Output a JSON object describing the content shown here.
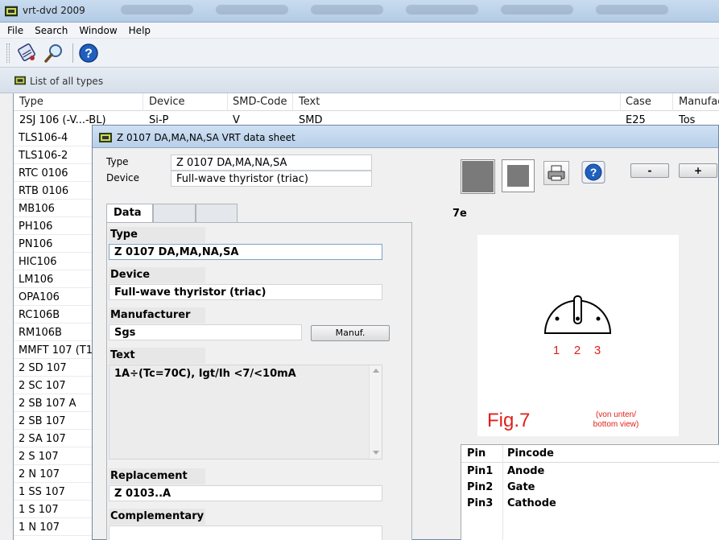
{
  "window": {
    "title": "vrt-dvd 2009"
  },
  "menu": [
    "File",
    "Search",
    "Window",
    "Help"
  ],
  "panel": {
    "caption": "List of all types"
  },
  "list": {
    "columns": [
      "Type",
      "Device",
      "SMD-Code",
      "Text",
      "Case",
      "Manufac"
    ],
    "first_row": {
      "type": "2SJ 106   (-V...-BL)",
      "device": "Si-P",
      "smd": "V",
      "text": "SMD",
      "case": "E25",
      "manufacturer": "Tos"
    },
    "types": [
      "TLS106-4",
      "TLS106-2",
      "RTC 0106",
      "RTB 0106",
      "MB106",
      "PH106",
      "PN106",
      "HIC106",
      "LM106",
      "OPA106",
      "RC106B",
      "RM106B",
      "MMFT 107  (T1",
      "2 SD 107",
      "2 SC 107",
      "2 SB 107 A",
      "2 SB 107",
      "2 SA 107",
      "2 S 107",
      "2 N 107",
      "1 SS 107",
      "1 S 107",
      "1 N 107"
    ]
  },
  "dialog": {
    "title": "Z 0107 DA,MA,NA,SA VRT data sheet",
    "type_label": "Type",
    "type_value": "Z 0107 DA,MA,NA,SA",
    "device_label": "Device",
    "device_value": "Full-wave thyristor (triac)",
    "tab_active": "Data",
    "sections": {
      "type_label": "Type",
      "type_value": "Z 0107 DA,MA,NA,SA",
      "device_label": "Device",
      "device_value": "Full-wave thyristor (triac)",
      "manufacturer_label": "Manufacturer",
      "manufacturer_value": "Sgs",
      "manuf_button": "Manuf.",
      "text_label": "Text",
      "text_value": "1A÷(Tc=70C), Igt/Ih <7/<10mA",
      "replacement_label": "Replacement",
      "replacement_value": "Z 0103..A",
      "complementary_label": "Complementary",
      "complementary_value": ""
    },
    "minus_button": "-",
    "plus_button": "+",
    "figure": {
      "code": "7e",
      "pin_numbers": [
        "1",
        "2",
        "3"
      ],
      "fig_label": "Fig.7",
      "view_note_line1": "(von unten/",
      "view_note_line2": "bottom view)"
    },
    "pin_table": {
      "headers": [
        "Pin",
        "Pincode"
      ],
      "rows": [
        {
          "pin": "Pin1",
          "code": "Anode"
        },
        {
          "pin": "Pin2",
          "code": "Gate"
        },
        {
          "pin": "Pin3",
          "code": "Cathode"
        }
      ]
    }
  },
  "colors": {
    "titlebar": "#c2d6ec",
    "figure_red": "#e0201a",
    "help_blue": "#1f5fbf"
  }
}
